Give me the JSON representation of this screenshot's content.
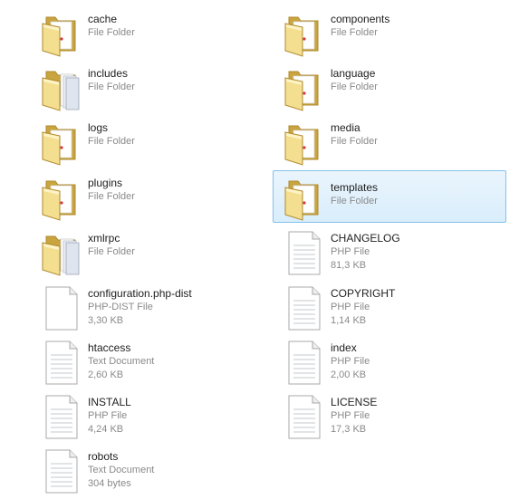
{
  "files": [
    {
      "name": "cache",
      "type": "File Folder",
      "kind": "folder"
    },
    {
      "name": "includes",
      "type": "File Folder",
      "kind": "folder-open"
    },
    {
      "name": "logs",
      "type": "File Folder",
      "kind": "folder"
    },
    {
      "name": "plugins",
      "type": "File Folder",
      "kind": "folder"
    },
    {
      "name": "xmlrpc",
      "type": "File Folder",
      "kind": "folder-open"
    },
    {
      "name": "configuration.php-dist",
      "type": "PHP-DIST File",
      "size": "3,30 KB",
      "kind": "file-blank"
    },
    {
      "name": "htaccess",
      "type": "Text Document",
      "size": "2,60 KB",
      "kind": "file-text"
    },
    {
      "name": "INSTALL",
      "type": "PHP File",
      "size": "4,24 KB",
      "kind": "file-text"
    },
    {
      "name": "robots",
      "type": "Text Document",
      "size": "304 bytes",
      "kind": "file-text"
    },
    {
      "name": "components",
      "type": "File Folder",
      "kind": "folder"
    },
    {
      "name": "language",
      "type": "File Folder",
      "kind": "folder"
    },
    {
      "name": "media",
      "type": "File Folder",
      "kind": "folder"
    },
    {
      "name": "templates",
      "type": "File Folder",
      "kind": "folder",
      "selected": true
    },
    {
      "name": "CHANGELOG",
      "type": "PHP File",
      "size": "81,3 KB",
      "kind": "file-text"
    },
    {
      "name": "COPYRIGHT",
      "type": "PHP File",
      "size": "1,14 KB",
      "kind": "file-text"
    },
    {
      "name": "index",
      "type": "PHP File",
      "size": "2,00 KB",
      "kind": "file-text"
    },
    {
      "name": "LICENSE",
      "type": "PHP File",
      "size": "17,3 KB",
      "kind": "file-text"
    }
  ],
  "icons": {
    "folder-icon": "closed folder",
    "folder-open-icon": "folder with papers",
    "file-blank-icon": "blank document",
    "file-text-icon": "text document"
  },
  "colors": {
    "folder_back": "#c9a43f",
    "folder_front": "#f3df8f",
    "folder_edge": "#b08a2e",
    "selection_fill": "#d9edfb",
    "selection_border": "#84c1ea",
    "name_text": "#1e1e1e",
    "meta_text": "#8a8a8a"
  }
}
